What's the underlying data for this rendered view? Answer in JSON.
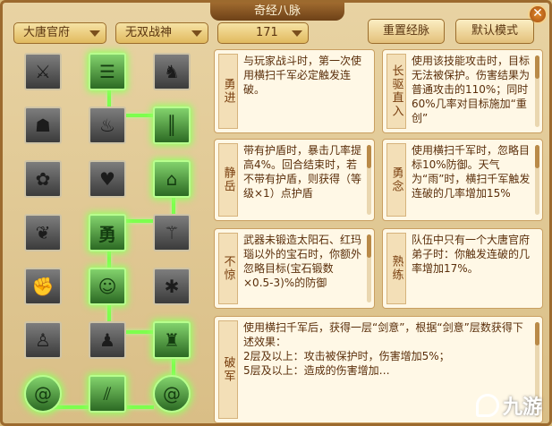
{
  "window": {
    "title": "奇经八脉",
    "close_symbol": "✕"
  },
  "filters": {
    "faction": {
      "value": "大唐官府"
    },
    "style": {
      "value": "无双战神"
    },
    "level": {
      "value": "171"
    }
  },
  "buttons": {
    "reset_label": "重置经脉",
    "default_label": "默认模式"
  },
  "skill_tree": {
    "nodes": [
      {
        "id": "r1c1",
        "icon": "broken-blade-icon",
        "active": false
      },
      {
        "id": "r1c2",
        "icon": "scroll-icon",
        "active": true
      },
      {
        "id": "r1c3",
        "icon": "warrior-icon",
        "active": false
      },
      {
        "id": "r2c1",
        "icon": "helmet-icon",
        "active": false
      },
      {
        "id": "r2c2",
        "icon": "flame-figure-icon",
        "active": false
      },
      {
        "id": "r2c3",
        "icon": "bamboo-icon",
        "active": true
      },
      {
        "id": "r3c1",
        "icon": "lotus-icon",
        "active": false
      },
      {
        "id": "r3c2",
        "icon": "heart-hands-icon",
        "active": false
      },
      {
        "id": "r3c3",
        "icon": "temple-icon",
        "active": true
      },
      {
        "id": "r4c1",
        "icon": "heart-ornament-icon",
        "active": false
      },
      {
        "id": "r4c2",
        "icon": "brave-seal-icon",
        "active": true,
        "text": "勇"
      },
      {
        "id": "r4c3",
        "icon": "spear-figure-icon",
        "active": false
      },
      {
        "id": "r5c1",
        "icon": "sword-fist-icon",
        "active": false
      },
      {
        "id": "r5c2",
        "icon": "thinking-warrior-icon",
        "active": true
      },
      {
        "id": "r5c3",
        "icon": "spider-icon",
        "active": false
      },
      {
        "id": "r6c1",
        "icon": "kneeling-figure-icon",
        "active": false
      },
      {
        "id": "r6c2",
        "icon": "gourd-figure-icon",
        "active": false
      },
      {
        "id": "r6c3",
        "icon": "lantern-figure-icon",
        "active": true
      },
      {
        "id": "r7c1",
        "icon": "swirl-icon",
        "active": true
      },
      {
        "id": "r7c2",
        "icon": "triple-blades-icon",
        "active": true
      },
      {
        "id": "r7c3",
        "icon": "swirl-right-icon",
        "active": true
      }
    ]
  },
  "traits": [
    {
      "label": "勇进",
      "text": "与玩家战斗时，第一次使用横扫千军必定触发连破。"
    },
    {
      "label": "长驱直入",
      "text": "使用该技能攻击时，目标无法被保护。伤害结果为普通攻击的110%；同时60%几率对目标施加“重创”"
    },
    {
      "label": "静岳",
      "text": "带有护盾时，暴击几率提高4%。回合结束时，若不带有护盾，则获得（等级×1）点护盾"
    },
    {
      "label": "勇念",
      "text": "使用横扫千军时，忽略目标10%防御。天气为“雨”时，横扫千军触发连破的几率增加15%"
    },
    {
      "label": "不惊",
      "text": "武器未锻造太阳石、红玛瑙以外的宝石时，你额外忽略目标(宝石锻数×0.5-3)%的防御"
    },
    {
      "label": "熟练",
      "text": "队伍中只有一个大唐官府弟子时：你触发连破的几率增加17%。"
    },
    {
      "label": "破军",
      "text": "使用横扫千军后，获得一层“剑意”，根据“剑意”层数获得下述效果：\n2层及以上：攻击被保护时，伤害增加5%；\n5层及以上：造成的伤害增加…"
    }
  ],
  "watermark": {
    "text": "九游"
  }
}
